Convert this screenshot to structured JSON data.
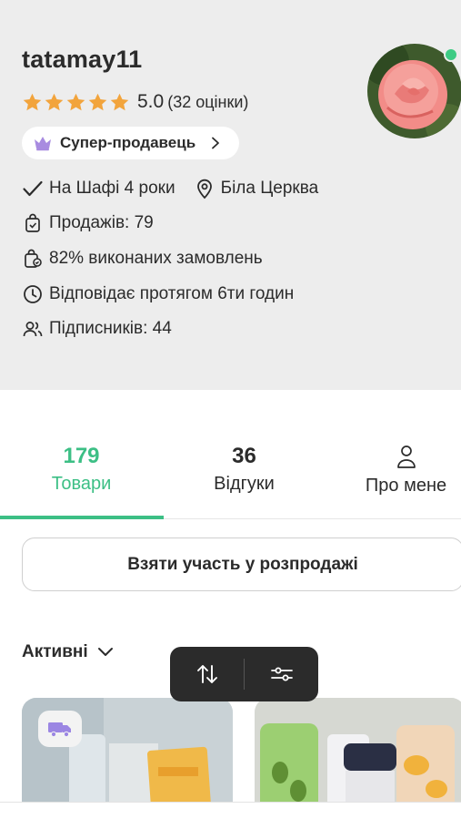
{
  "profile": {
    "username": "tatamay11",
    "rating_value": "5.0",
    "rating_count": "(32 оцінки)",
    "stars": 5,
    "badge_label": "Супер-продавець",
    "tenure": "На Шафі 4 роки",
    "location": "Біла Церква",
    "sales": "Продажів: 79",
    "completed": "82% виконаних замовлень",
    "response": "Відповідає протягом 6ти годин",
    "followers": "Підписників: 44",
    "online": true
  },
  "tabs": [
    {
      "count": "179",
      "label": "Товари",
      "active": true
    },
    {
      "count": "36",
      "label": "Відгуки",
      "active": false
    },
    {
      "icon": "person-icon",
      "label": "Про мене",
      "active": false
    }
  ],
  "sale_button_label": "Взяти участь у розпродажі",
  "filter": {
    "selected": "Активні"
  },
  "toolbar": {
    "icons": [
      "sort-icon",
      "filter-sliders-icon"
    ]
  },
  "colors": {
    "accent": "#3cbf85",
    "star": "#f2a43c",
    "crown": "#a88be0",
    "header_bg": "#ededed",
    "toolbar_bg": "#2b2b2b"
  }
}
